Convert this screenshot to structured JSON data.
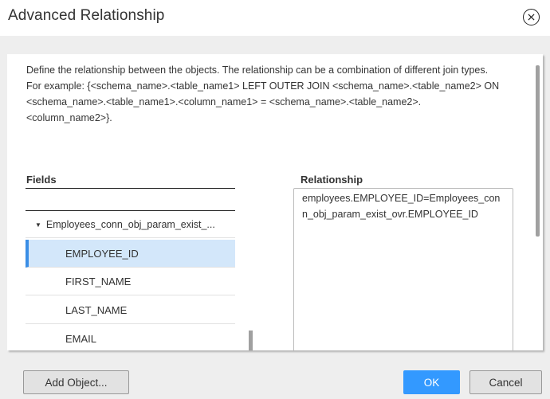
{
  "dialog": {
    "title": "Advanced Relationship",
    "close_icon": "close-circle-icon"
  },
  "description": {
    "line1": "Define the relationship between the objects. The relationship can be a combination of different join types.",
    "line2": "For example: {<schema_name>.<table_name1> LEFT OUTER JOIN <schema_name>.<table_name2> ON <schema_name>.<table_name1>.<column_name1> = <schema_name>.<table_name2>.<column_name2>}."
  },
  "fields": {
    "label": "Fields",
    "search_value": "",
    "tree": {
      "parent": {
        "label": "Employees_conn_obj_param_exist_...",
        "expanded": true,
        "icon": "caret-down-icon"
      },
      "children": [
        {
          "label": "EMPLOYEE_ID",
          "selected": true
        },
        {
          "label": "FIRST_NAME",
          "selected": false
        },
        {
          "label": "LAST_NAME",
          "selected": false
        },
        {
          "label": "EMAIL",
          "selected": false
        }
      ]
    }
  },
  "relationship": {
    "label": "Relationship",
    "value": "employees.EMPLOYEE_ID=Employees_conn_obj_param_exist_ovr.EMPLOYEE_ID"
  },
  "footer": {
    "add_object_label": "Add Object...",
    "ok_label": "OK",
    "cancel_label": "Cancel"
  },
  "colors": {
    "primary": "#3399ff",
    "selection_bg": "#d3e7fa",
    "selection_bar": "#3a8ee6"
  }
}
